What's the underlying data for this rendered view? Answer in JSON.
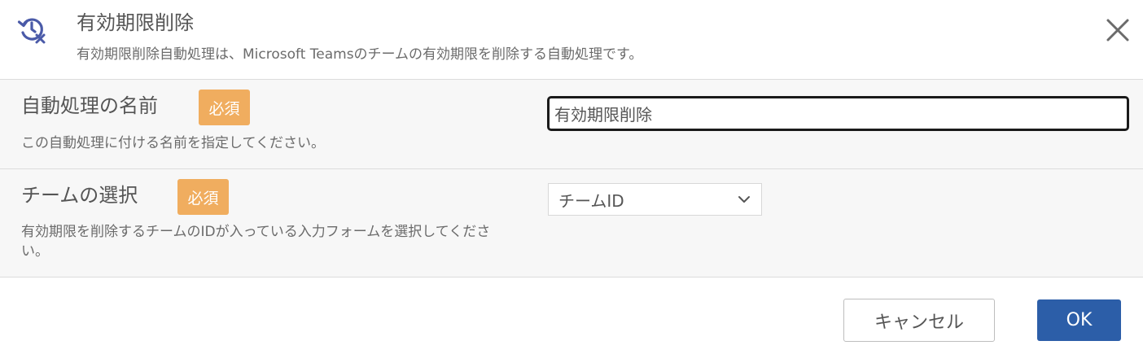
{
  "header": {
    "icon": "history-delete-icon",
    "title": "有効期限削除",
    "subtitle": "有効期限削除自動処理は、Microsoft Teamsのチームの有効期限を削除する自動処理です。",
    "close_icon": "close-icon"
  },
  "fields": {
    "name": {
      "label": "自動処理の名前",
      "required_badge": "必須",
      "description": "この自動処理に付ける名前を指定してください。",
      "value": "有効期限削除"
    },
    "team": {
      "label": "チームの選択",
      "required_badge": "必須",
      "description": "有効期限を削除するチームのIDが入っている入力フォームを選択してください。",
      "selected": "チームID"
    }
  },
  "footer": {
    "cancel_label": "キャンセル",
    "ok_label": "OK"
  },
  "colors": {
    "accent": "#2c5ea8",
    "icon": "#4a5aa8",
    "required_badge": "#f0ad5f",
    "row_background": "#f7f7f7"
  }
}
